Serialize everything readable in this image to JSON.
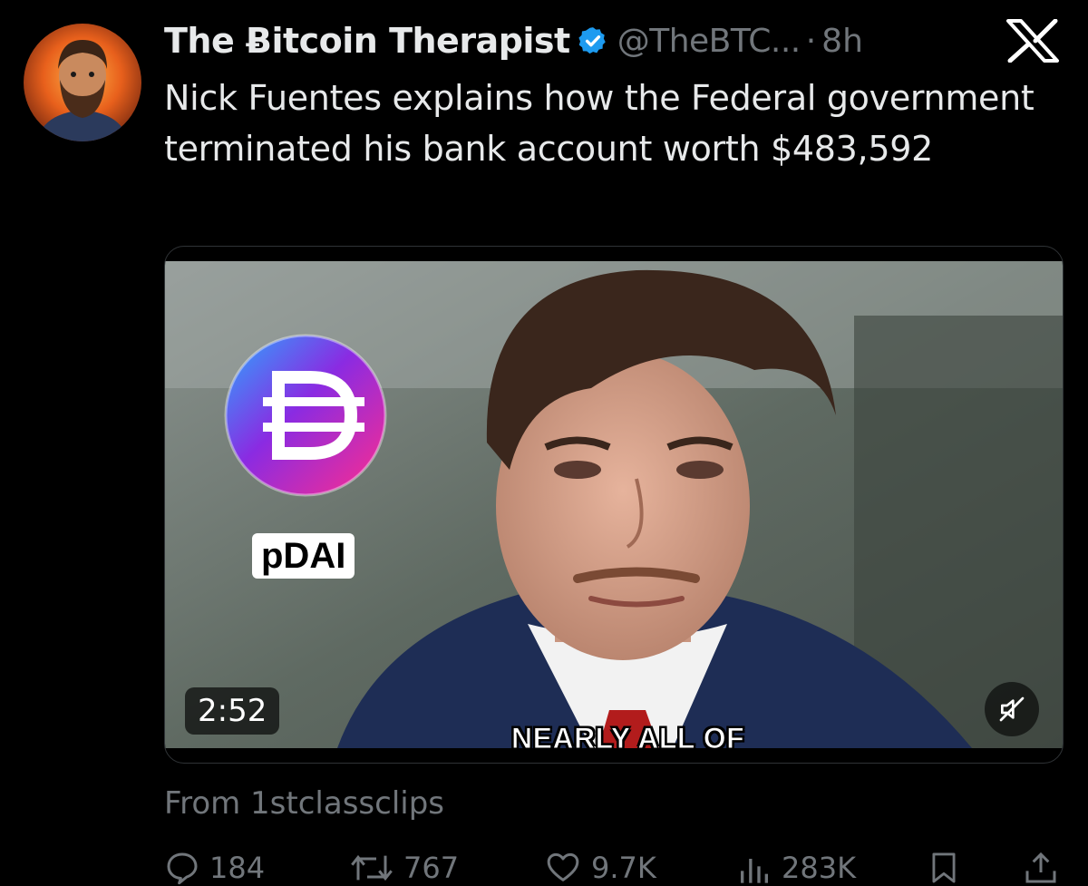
{
  "author": {
    "display_name": "The Ƀitcoin Therapist",
    "handle": "@TheBTC...",
    "separator": "·",
    "time_ago": "8h",
    "verified": true,
    "verified_color": "#1d9bf0"
  },
  "tweet": {
    "text": "Nick Fuentes explains how the Federal government terminated his bank account worth $483,592"
  },
  "media": {
    "token_label": "pDAI",
    "duration": "2:52",
    "caption": "NEARLY ALL OF",
    "source": "From 1stclassclips"
  },
  "actions": {
    "replies": "184",
    "reposts": "767",
    "likes": "9.7K",
    "views": "283K"
  },
  "icons": {
    "platform": "x-logo-icon",
    "verified": "verified-badge-icon",
    "mute": "volume-muted-icon",
    "reply": "reply-icon",
    "repost": "repost-icon",
    "like": "heart-icon",
    "views": "views-icon",
    "bookmark": "bookmark-icon",
    "share": "share-icon"
  }
}
